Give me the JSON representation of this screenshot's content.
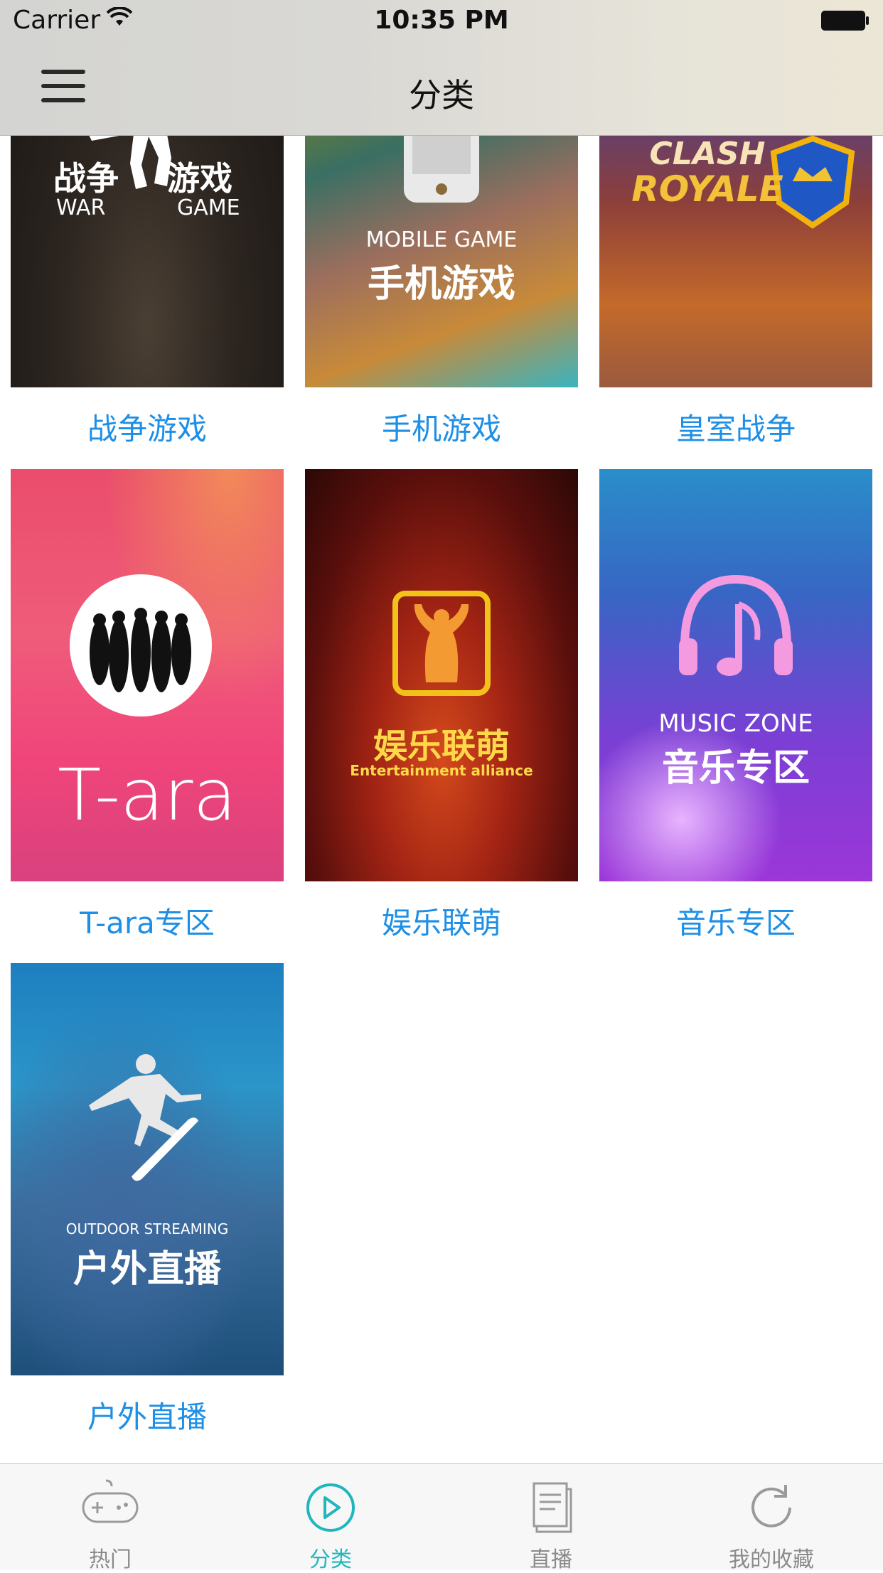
{
  "status_bar": {
    "carrier": "Carrier",
    "time": "10:35 PM"
  },
  "nav": {
    "title": "分类"
  },
  "categories": [
    {
      "label": "战争游戏",
      "art": {
        "cn_left": "战争",
        "cn_right": "游戏",
        "en_left": "WAR",
        "en_right": "GAME"
      }
    },
    {
      "label": "手机游戏",
      "art": {
        "en": "MOBILE GAME",
        "cn": "手机游戏"
      }
    },
    {
      "label": "皇室战争",
      "art": {
        "line1": "CLASH",
        "line2": "ROYALE"
      }
    },
    {
      "label": "T-ara专区",
      "art": {
        "text": "T-ara"
      }
    },
    {
      "label": "娱乐联萌",
      "art": {
        "cn": "娱乐联萌",
        "en": "Entertainment alliance"
      }
    },
    {
      "label": "音乐专区",
      "art": {
        "en": "MUSIC ZONE",
        "cn": "音乐专区"
      }
    },
    {
      "label": "户外直播",
      "art": {
        "en": "OUTDOOR STREAMING",
        "cn": "户外直播"
      }
    }
  ],
  "tabs": [
    {
      "label": "热门",
      "icon": "gamepad-icon",
      "active": false
    },
    {
      "label": "分类",
      "icon": "play-circle-icon",
      "active": true
    },
    {
      "label": "直播",
      "icon": "document-icon",
      "active": false
    },
    {
      "label": "我的收藏",
      "icon": "refresh-icon",
      "active": false
    }
  ],
  "colors": {
    "label": "#1e8fe6",
    "tab_active": "#1fb6bd",
    "tab_inactive": "#8a8a8a"
  }
}
